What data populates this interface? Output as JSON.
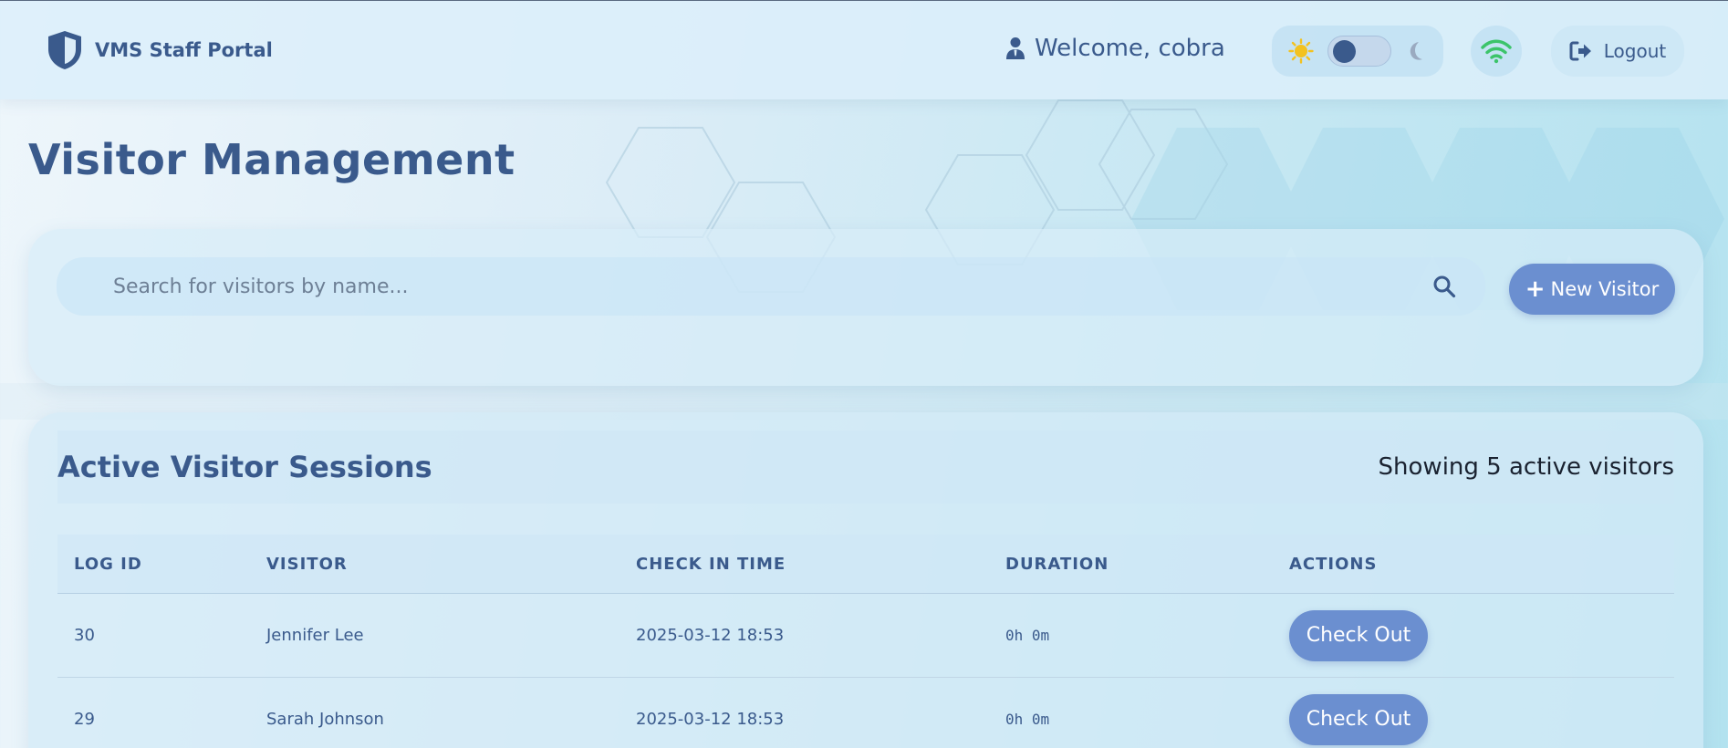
{
  "header": {
    "brand_title": "VMS Staff Portal",
    "welcome_text": "Welcome, cobra",
    "logout_label": "Logout",
    "theme_toggle": "light"
  },
  "page": {
    "title": "Visitor Management"
  },
  "search": {
    "placeholder": "Search for visitors by name...",
    "value": "",
    "new_visitor_label": "New Visitor"
  },
  "sessions": {
    "title": "Active Visitor Sessions",
    "count_text": "Showing 5 active visitors",
    "columns": [
      "LOG ID",
      "VISITOR",
      "CHECK IN TIME",
      "DURATION",
      "ACTIONS"
    ],
    "rows": [
      {
        "log_id": "30",
        "visitor": "Jennifer Lee",
        "check_in": "2025-03-12 18:53",
        "duration": "0h 0m",
        "action": "Check Out"
      },
      {
        "log_id": "29",
        "visitor": "Sarah Johnson",
        "check_in": "2025-03-12 18:53",
        "duration": "0h 0m",
        "action": "Check Out"
      }
    ]
  },
  "colors": {
    "accent": "#6b8fd0",
    "primary_text": "#3a5a8c",
    "wifi_status": "#3cc46a",
    "sun": "#f3c21f"
  },
  "icons": {
    "brand": "shield-icon",
    "user": "user-icon",
    "sun": "sun-icon",
    "moon": "moon-icon",
    "wifi": "wifi-icon",
    "logout": "logout-icon",
    "search": "search-icon",
    "plus": "plus-icon"
  }
}
